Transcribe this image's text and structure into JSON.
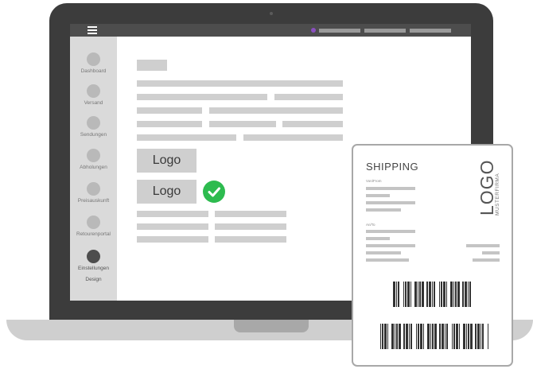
{
  "app": {
    "menu_icon": "hamburger-menu-icon",
    "accent_color": "#8a4fbf",
    "sidebar": {
      "items": [
        {
          "label": "Dashboard",
          "active": false
        },
        {
          "label": "Versand",
          "active": false
        },
        {
          "label": "Sendungen",
          "active": false
        },
        {
          "label": "Abholungen",
          "active": false
        },
        {
          "label": "Preisauskunft",
          "active": false
        },
        {
          "label": "Retourenportal",
          "active": false
        },
        {
          "label": "Einstellungen",
          "sublabel": "Design",
          "active": true
        }
      ]
    },
    "main": {
      "logo_option_1": "Logo",
      "logo_option_2": "Logo",
      "selected_icon": "checkmark-icon",
      "selected_color": "#2dbb4f"
    }
  },
  "shipping_label": {
    "title": "SHIPPING",
    "from_label": "Von/From",
    "to_label": "An/To",
    "logo_text": "LOGO",
    "company": "MUSTERFIRMA"
  }
}
